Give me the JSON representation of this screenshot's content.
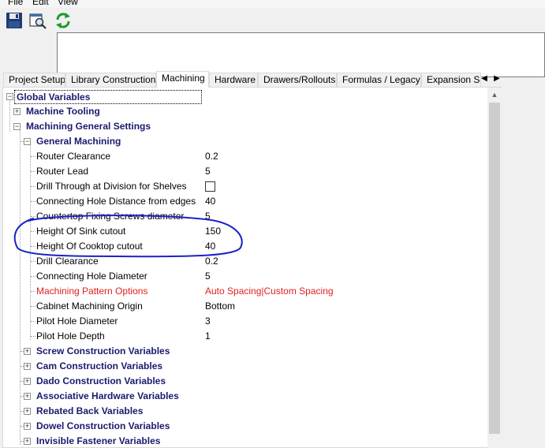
{
  "menu": {
    "file": "File",
    "edit": "Edit",
    "view": "View"
  },
  "toolbar": {
    "save_icon": "save-icon",
    "preview_icon": "print-preview-icon",
    "refresh_icon": "refresh-icon"
  },
  "tabs": [
    "Project Setup",
    "Library Construction",
    "Machining",
    "Hardware",
    "Drawers/Rollouts",
    "Formulas / Legacy",
    "Expansion Se"
  ],
  "active_tab": "Machining",
  "tree": {
    "root": "Global Variables",
    "machine_tooling": "Machine Tooling",
    "machining_general": "Machining General Settings",
    "general_machining": "General Machining",
    "properties": [
      {
        "label": "Router Clearance",
        "value": "0.2"
      },
      {
        "label": "Router Lead",
        "value": "5"
      },
      {
        "label": "Drill Through at Division for Shelves",
        "value": ""
      },
      {
        "label": "Connecting Hole Distance from edges",
        "value": "40"
      },
      {
        "label": "Countertop Fixing Screws diameter",
        "value": "5"
      },
      {
        "label": "Height Of Sink cutout",
        "value": "150"
      },
      {
        "label": "Height Of Cooktop cutout",
        "value": "40"
      },
      {
        "label": "Drill Clearance",
        "value": "0.2"
      },
      {
        "label": "Connecting Hole Diameter",
        "value": "5"
      },
      {
        "label": "Machining Pattern Options",
        "value": "Auto Spacing|Custom Spacing"
      },
      {
        "label": "Cabinet Machining Origin",
        "value": "Bottom"
      },
      {
        "label": "Pilot Hole Diameter",
        "value": "3"
      },
      {
        "label": "Pilot Hole Depth",
        "value": "1"
      }
    ],
    "groups": [
      "Screw Construction Variables",
      "Cam Construction Variables",
      "Dado Construction Variables",
      "Associative Hardware Variables",
      "Rebated Back Variables",
      "Dowel Construction Variables",
      "Invisible Fastener Variables"
    ]
  },
  "colors": {
    "highlight_text": "#e02020",
    "annotation": "#1a22c8",
    "group_text": "#1a1a6e"
  }
}
